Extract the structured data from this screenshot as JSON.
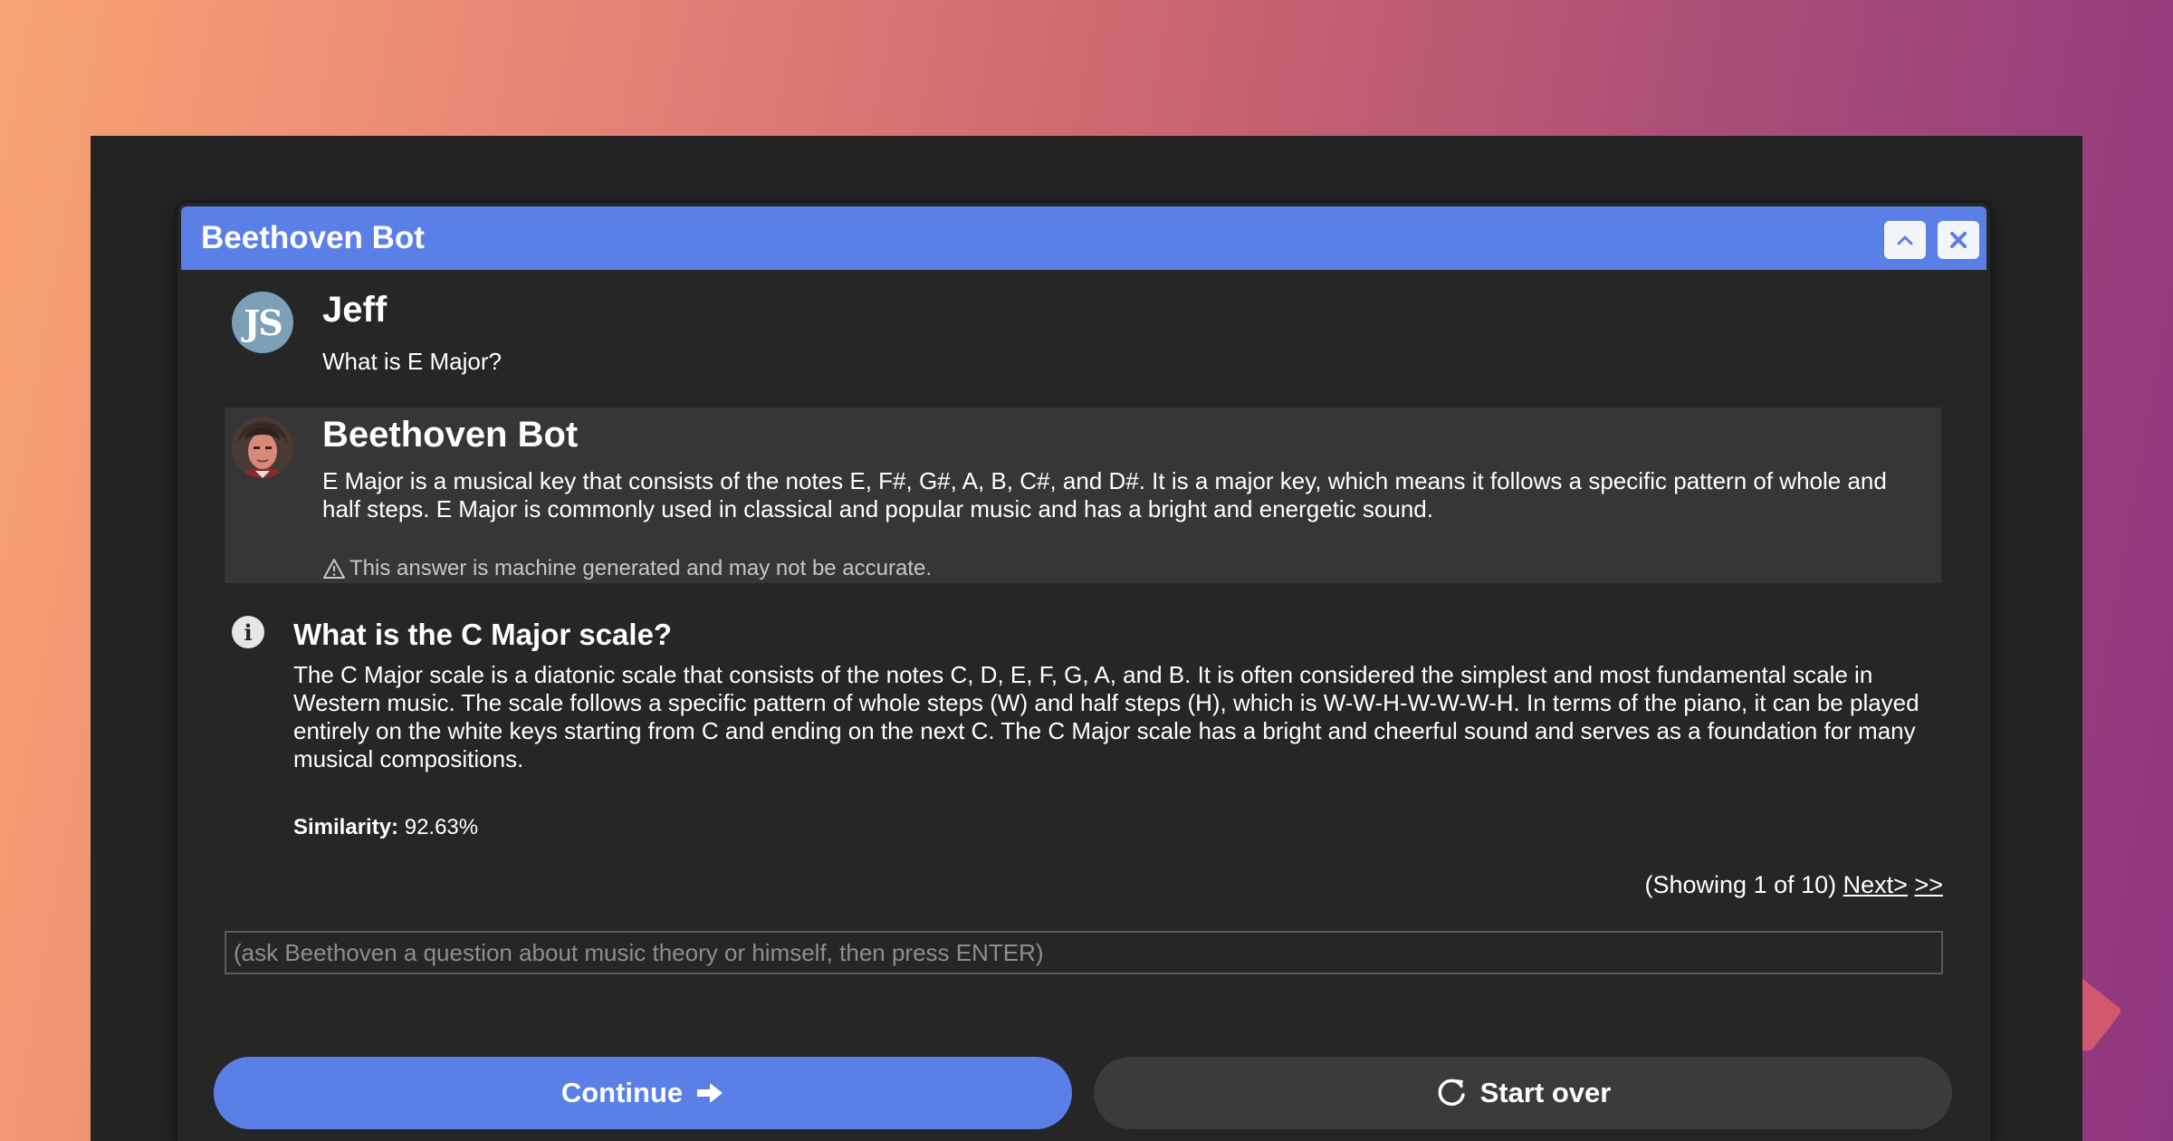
{
  "window": {
    "title": "Beethoven Bot"
  },
  "conversation": [
    {
      "sender": "Jeff",
      "avatar_initials": "JS",
      "text": "What is E Major?"
    },
    {
      "sender": "Beethoven Bot",
      "text": "E Major is a musical key that consists of the notes E, F#, G#, A, B, C#, and D#. It is a major key, which means it follows a specific pattern of whole and half steps. E Major is commonly used in classical and popular music and has a bright and energetic sound.",
      "disclaimer": "This answer is machine generated and may not be accurate."
    }
  ],
  "related": {
    "title": "What is the C Major scale?",
    "text": "The C Major scale is a diatonic scale that consists of the notes C, D, E, F, G, A, and B. It is often considered the simplest and most fundamental scale in Western music. The scale follows a specific pattern of whole steps (W) and half steps (H), which is W-W-H-W-W-W-H. In terms of the piano, it can be played entirely on the white keys starting from C and ending on the next C. The C Major scale has a bright and cheerful sound and serves as a foundation for many musical compositions.",
    "similarity_label": "Similarity:",
    "similarity_value": "92.63%"
  },
  "pager": {
    "showing": "(Showing 1 of 10)",
    "next_label": "Next>",
    "last_label": ">>"
  },
  "input": {
    "placeholder": "(ask Beethoven a question about music theory or himself, then press ENTER)",
    "value": ""
  },
  "buttons": {
    "continue_label": "Continue",
    "start_over_label": "Start over"
  },
  "colors": {
    "accent": "#5a80e8",
    "panel": "#262626",
    "bot_message_bg": "#363636"
  }
}
